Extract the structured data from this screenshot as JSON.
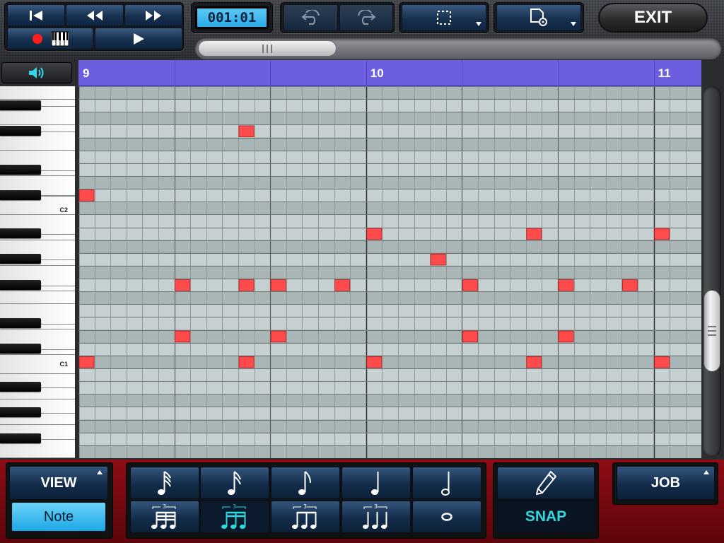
{
  "transport": {
    "rewind_icon": "skip-to-start-icon",
    "rew_icon": "rewind-icon",
    "ff_icon": "fast-forward-icon",
    "record_icon": "record-icon",
    "keyboard_icon": "piano-keys-icon",
    "play_icon": "play-icon",
    "position": "001:01"
  },
  "toolbar": {
    "undo_icon": "undo-icon",
    "redo_icon": "redo-icon",
    "select_icon": "selection-box-icon",
    "file_settings_icon": "file-settings-icon",
    "exit_label": "EXIT"
  },
  "keyboard": {
    "speaker_icon": "speaker-icon",
    "c2_label": "C2",
    "c1_label": "C1"
  },
  "ruler": {
    "bars": [
      "9",
      "10",
      "11"
    ],
    "color": "#6b5fe0"
  },
  "grid": {
    "note_color": "#ff4b4b",
    "rows": 29,
    "steps": 39,
    "notes": [
      {
        "row": 3,
        "step": 10
      },
      {
        "row": 8,
        "step": 0
      },
      {
        "row": 11,
        "step": 18
      },
      {
        "row": 11,
        "step": 28
      },
      {
        "row": 11,
        "step": 36
      },
      {
        "row": 13,
        "step": 22
      },
      {
        "row": 15,
        "step": 6
      },
      {
        "row": 15,
        "step": 10
      },
      {
        "row": 15,
        "step": 12
      },
      {
        "row": 15,
        "step": 16
      },
      {
        "row": 15,
        "step": 24
      },
      {
        "row": 15,
        "step": 30
      },
      {
        "row": 15,
        "step": 34
      },
      {
        "row": 19,
        "step": 6
      },
      {
        "row": 19,
        "step": 12
      },
      {
        "row": 19,
        "step": 24
      },
      {
        "row": 19,
        "step": 30
      },
      {
        "row": 21,
        "step": 0
      },
      {
        "row": 21,
        "step": 10
      },
      {
        "row": 21,
        "step": 18
      },
      {
        "row": 21,
        "step": 28
      },
      {
        "row": 21,
        "step": 36
      }
    ]
  },
  "bottom": {
    "view_label": "VIEW",
    "view_mode": "Note",
    "note_lengths_top": [
      "1/32-note-icon",
      "1/16-note-icon",
      "1/8-note-icon",
      "1/4-note-icon",
      "1/2-note-icon"
    ],
    "note_lengths_bottom": [
      "1/32-triplet-icon",
      "1/16-triplet-icon",
      "1/8-triplet-icon",
      "1/4-triplet-icon",
      "whole-note-icon"
    ],
    "selected_length": "1/16-triplet",
    "pencil_icon": "pencil-icon",
    "snap_label": "SNAP",
    "job_label": "JOB"
  }
}
